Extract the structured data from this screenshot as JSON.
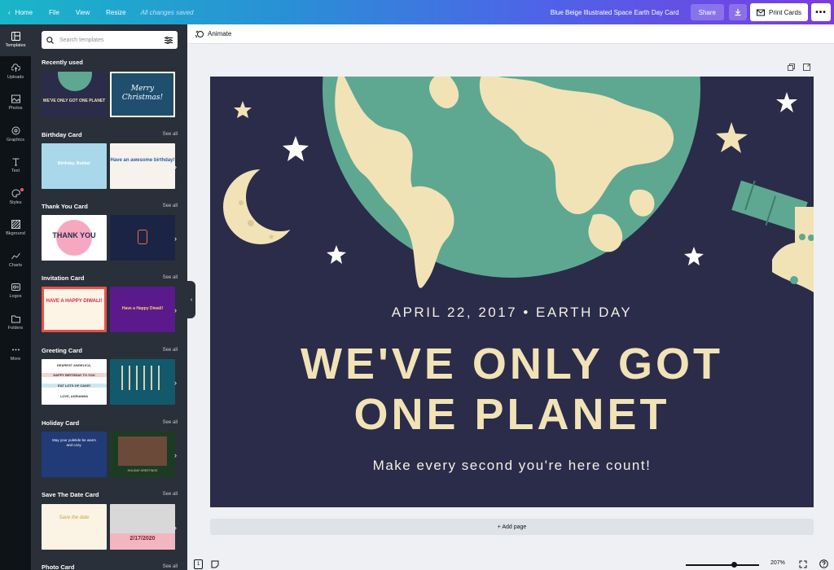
{
  "topbar": {
    "home": "Home",
    "file": "File",
    "view": "View",
    "resize": "Resize",
    "saved_status": "All changes saved",
    "doc_title": "Blue Beige Illustrated Space Earth Day Card",
    "share": "Share",
    "print": "Print Cards",
    "more": "•••"
  },
  "rail": {
    "items": [
      {
        "label": "Templates",
        "icon": "templates-icon"
      },
      {
        "label": "Uploads",
        "icon": "upload-icon"
      },
      {
        "label": "Photos",
        "icon": "image-icon"
      },
      {
        "label": "Graphics",
        "icon": "shapes-icon"
      },
      {
        "label": "Text",
        "icon": "text-icon"
      },
      {
        "label": "Styles",
        "icon": "palette-icon"
      },
      {
        "label": "Bkground",
        "icon": "background-icon"
      },
      {
        "label": "Charts",
        "icon": "chart-icon"
      },
      {
        "label": "Logos",
        "icon": "logo-icon"
      },
      {
        "label": "Folders",
        "icon": "folder-icon"
      },
      {
        "label": "More",
        "icon": "more-icon"
      }
    ]
  },
  "panel": {
    "search_placeholder": "Search templates",
    "sections": [
      {
        "title": "Recently used",
        "see_all": ""
      },
      {
        "title": "Birthday Card",
        "see_all": "See all"
      },
      {
        "title": "Thank You Card",
        "see_all": "See all"
      },
      {
        "title": "Invitation Card",
        "see_all": "See all"
      },
      {
        "title": "Greeting Card",
        "see_all": "See all"
      },
      {
        "title": "Holiday Card",
        "see_all": "See all"
      },
      {
        "title": "Save The Date Card",
        "see_all": "See all"
      },
      {
        "title": "Photo Card",
        "see_all": "See all"
      }
    ],
    "thumbs": {
      "recent1": "WE'VE ONLY GOT ONE PLANET",
      "recent2": "Merry Christmas!",
      "birthday1": "Birthday, Bubba!",
      "birthday2": "Have an awesome birthday!",
      "thanks1": "THANK YOU",
      "invite1": "HAVE A HAPPY DIWALI!",
      "invite2": "Have a Happy Diwali!",
      "greet1_a": "DEAREST ANGELICA,",
      "greet1_b": "HAPPY BIRTHDAY TO YOU",
      "greet1_c": "EAT LOTS OF CAKE!",
      "greet1_d": "LOVE, ADRIANNA",
      "holiday1": "May your yuletide be warm and cozy.",
      "holiday2": "HOLIDAY GREETINGS",
      "savedate1": "Save the date",
      "savedate2": "2/17/2020"
    }
  },
  "editor": {
    "animate": "Animate",
    "add_page": "+ Add page",
    "zoom": "207%",
    "page_number": "1"
  },
  "card": {
    "date_line": "APRIL 22, 2017 • EARTH DAY",
    "headline_1": "WE'VE ONLY GOT",
    "headline_2": "ONE PLANET",
    "tagline": "Make every second you're here count!",
    "colors": {
      "background": "#2a2c4a",
      "ocean": "#5ea891",
      "land": "#f1e3b6",
      "star": "#f1e3b6"
    }
  }
}
